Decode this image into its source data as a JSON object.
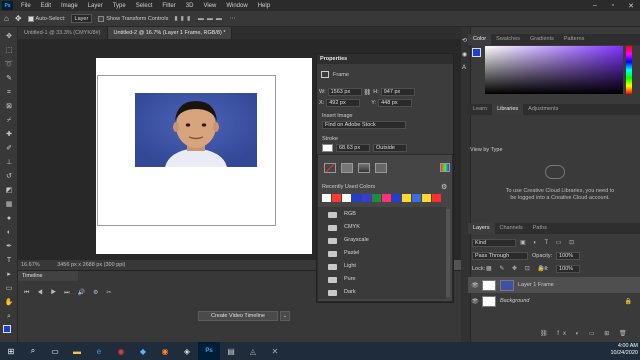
{
  "menu": [
    "File",
    "Edit",
    "Image",
    "Layer",
    "Type",
    "Select",
    "Filter",
    "3D",
    "View",
    "Window",
    "Help"
  ],
  "options": {
    "auto_select_label": "Auto-Select:",
    "auto_select_value": "Layer",
    "transform_label": "Show Transform Controls"
  },
  "tabs": [
    {
      "label": "Untitled-1 @ 33.3% (CMYK/8#)"
    },
    {
      "label": "Untitled-2 @ 16.7% (Layer 1 Frame, RGB/8) *"
    }
  ],
  "status": {
    "zoom": "16.67%",
    "doc": "3456 px x 2688 px (300 ppi)"
  },
  "timeline": {
    "title": "Timeline",
    "button": "Create Video Timeline"
  },
  "properties": {
    "title": "Properties",
    "type": "Frame",
    "w_label": "W:",
    "w": "1563 px",
    "h_label": "H:",
    "h": "947 px",
    "x_label": "X:",
    "x": "492 px",
    "y_label": "Y:",
    "y": "448 px",
    "insert_label": "Insert Image",
    "insert_value": "Find on Adobe Stock",
    "stroke_label": "Stroke",
    "stroke_value": "68.63 px",
    "stroke_align": "Outside",
    "recent_label": "Recently Used Colors",
    "recent_colors": [
      "#ffffff",
      "#ff3b2f",
      "#ffffff",
      "#1f3fd1",
      "#3a3ad8",
      "#1e8c3c",
      "#ff2f7a",
      "#1f3fd1",
      "#ffd92a",
      "#3a6ee0",
      "#ffd92a",
      "#ff2f2f"
    ],
    "folders": [
      "RGB",
      "CMYK",
      "Grayscale",
      "Pastel",
      "Light",
      "Pure",
      "Dark"
    ]
  },
  "color_panel": {
    "tabs": [
      "Color",
      "Swatches",
      "Gradients",
      "Patterns"
    ]
  },
  "lib_panel": {
    "tabs": [
      "Learn",
      "Libraries",
      "Adjustments"
    ],
    "view_by": "View by Type",
    "message": "To use Creative Cloud Libraries, you need to be logged into a Creative Cloud account."
  },
  "layers_panel": {
    "tabs": [
      "Layers",
      "Channels",
      "Paths"
    ],
    "kind": "Kind",
    "blend": "Pass Through",
    "opacity_label": "Opacity:",
    "opacity": "100%",
    "lock_label": "Lock:",
    "fill_label": "Fill:",
    "fill": "100%",
    "layers": [
      {
        "name": "Layer 1 Frame"
      },
      {
        "name": "Background"
      }
    ]
  },
  "clock": {
    "time": "4:00 AM",
    "date": "10/24/2020"
  }
}
